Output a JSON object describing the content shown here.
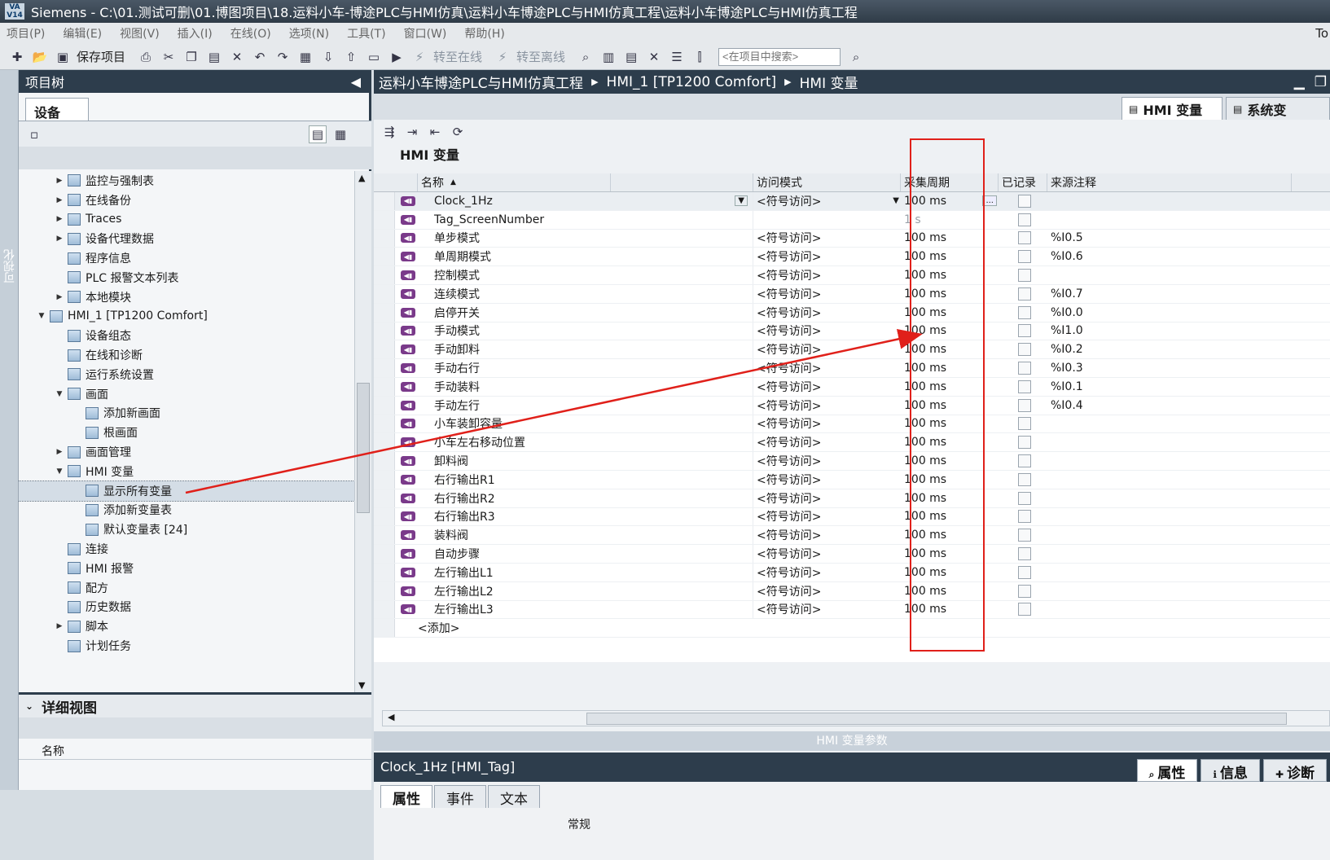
{
  "window": {
    "title": "Siemens  -  C:\\01.测试可删\\01.博图项目\\18.运料小车-博途PLC与HMI仿真\\运料小车博途PLC与HMI仿真工程\\运料小车博途PLC与HMI仿真工程",
    "logo": "VA V14",
    "right_text": "To"
  },
  "menu": [
    "项目(P)",
    "编辑(E)",
    "视图(V)",
    "插入(I)",
    "在线(O)",
    "选项(N)",
    "工具(T)",
    "窗口(W)",
    "帮助(H)"
  ],
  "toolbar": {
    "save_label": "保存项目",
    "go_online": "转至在线",
    "go_offline": "转至离线",
    "search_placeholder": "<在项目中搜索>"
  },
  "sidebar": {
    "vertical_label": "可视化"
  },
  "project_tree": {
    "title": "项目树",
    "tab": "设备",
    "items": [
      {
        "label": "监控与强制表",
        "level": 2,
        "arrow": "▶"
      },
      {
        "label": "在线备份",
        "level": 2,
        "arrow": "▶"
      },
      {
        "label": "Traces",
        "level": 2,
        "arrow": "▶"
      },
      {
        "label": "设备代理数据",
        "level": 2,
        "arrow": "▶"
      },
      {
        "label": "程序信息",
        "level": 2,
        "arrow": ""
      },
      {
        "label": "PLC 报警文本列表",
        "level": 2,
        "arrow": ""
      },
      {
        "label": "本地模块",
        "level": 2,
        "arrow": "▶"
      },
      {
        "label": "HMI_1 [TP1200 Comfort]",
        "level": 1,
        "arrow": "▼"
      },
      {
        "label": "设备组态",
        "level": 2,
        "arrow": ""
      },
      {
        "label": "在线和诊断",
        "level": 2,
        "arrow": ""
      },
      {
        "label": "运行系统设置",
        "level": 2,
        "arrow": ""
      },
      {
        "label": "画面",
        "level": 2,
        "arrow": "▼"
      },
      {
        "label": "添加新画面",
        "level": 3,
        "arrow": ""
      },
      {
        "label": "根画面",
        "level": 3,
        "arrow": ""
      },
      {
        "label": "画面管理",
        "level": 2,
        "arrow": "▶"
      },
      {
        "label": "HMI 变量",
        "level": 2,
        "arrow": "▼"
      },
      {
        "label": "显示所有变量",
        "level": 3,
        "arrow": "",
        "selected": true
      },
      {
        "label": "添加新变量表",
        "level": 3,
        "arrow": ""
      },
      {
        "label": "默认变量表 [24]",
        "level": 3,
        "arrow": ""
      },
      {
        "label": "连接",
        "level": 2,
        "arrow": ""
      },
      {
        "label": "HMI 报警",
        "level": 2,
        "arrow": ""
      },
      {
        "label": "配方",
        "level": 2,
        "arrow": ""
      },
      {
        "label": "历史数据",
        "level": 2,
        "arrow": ""
      },
      {
        "label": "脚本",
        "level": 2,
        "arrow": "▶"
      },
      {
        "label": "计划任务",
        "level": 2,
        "arrow": ""
      }
    ]
  },
  "detail_view": {
    "title": "详细视图",
    "column": "名称"
  },
  "breadcrumb": [
    "运料小车博途PLC与HMI仿真工程",
    "HMI_1 [TP1200 Comfort]",
    "HMI 变量"
  ],
  "editor_tabs": {
    "hmi_tags": "HMI 变量",
    "system_tags": "系统变"
  },
  "table": {
    "title": "HMI 变量",
    "columns": [
      "名称",
      "访问模式",
      "采集周期",
      "已记录",
      "来源注释"
    ],
    "rows": [
      {
        "name": "Clock_1Hz",
        "access": "<符号访问>",
        "cycle": "100 ms",
        "comment": ""
      },
      {
        "name": "Tag_ScreenNumber",
        "access": "",
        "cycle": "1 s",
        "comment": ""
      },
      {
        "name": "单步模式",
        "access": "<符号访问>",
        "cycle": "100 ms",
        "comment": "%I0.5"
      },
      {
        "name": "单周期模式",
        "access": "<符号访问>",
        "cycle": "100 ms",
        "comment": "%I0.6"
      },
      {
        "name": "控制模式",
        "access": "<符号访问>",
        "cycle": "100 ms",
        "comment": ""
      },
      {
        "name": "连续模式",
        "access": "<符号访问>",
        "cycle": "100 ms",
        "comment": "%I0.7"
      },
      {
        "name": "启停开关",
        "access": "<符号访问>",
        "cycle": "100 ms",
        "comment": "%I0.0"
      },
      {
        "name": "手动模式",
        "access": "<符号访问>",
        "cycle": "100 ms",
        "comment": "%I1.0"
      },
      {
        "name": "手动卸料",
        "access": "<符号访问>",
        "cycle": "100 ms",
        "comment": "%I0.2"
      },
      {
        "name": "手动右行",
        "access": "<符号访问>",
        "cycle": "100 ms",
        "comment": "%I0.3"
      },
      {
        "name": "手动装料",
        "access": "<符号访问>",
        "cycle": "100 ms",
        "comment": "%I0.1"
      },
      {
        "name": "手动左行",
        "access": "<符号访问>",
        "cycle": "100 ms",
        "comment": "%I0.4"
      },
      {
        "name": "小车装卸容量",
        "access": "<符号访问>",
        "cycle": "100 ms",
        "comment": ""
      },
      {
        "name": "小车左右移动位置",
        "access": "<符号访问>",
        "cycle": "100 ms",
        "comment": ""
      },
      {
        "name": "卸料阀",
        "access": "<符号访问>",
        "cycle": "100 ms",
        "comment": ""
      },
      {
        "name": "右行输出R1",
        "access": "<符号访问>",
        "cycle": "100 ms",
        "comment": ""
      },
      {
        "name": "右行输出R2",
        "access": "<符号访问>",
        "cycle": "100 ms",
        "comment": ""
      },
      {
        "name": "右行输出R3",
        "access": "<符号访问>",
        "cycle": "100 ms",
        "comment": ""
      },
      {
        "name": "装料阀",
        "access": "<符号访问>",
        "cycle": "100 ms",
        "comment": ""
      },
      {
        "name": "自动步骤",
        "access": "<符号访问>",
        "cycle": "100 ms",
        "comment": ""
      },
      {
        "name": "左行输出L1",
        "access": "<符号访问>",
        "cycle": "100 ms",
        "comment": ""
      },
      {
        "name": "左行输出L2",
        "access": "<符号访问>",
        "cycle": "100 ms",
        "comment": ""
      },
      {
        "name": "左行输出L3",
        "access": "<符号访问>",
        "cycle": "100 ms",
        "comment": ""
      }
    ],
    "add_row": "<添加>",
    "cycle_button": "..."
  },
  "params_bar": "HMI 变量参数",
  "inspector": {
    "title": "Clock_1Hz [HMI_Tag]",
    "tabs": [
      "属性",
      "事件",
      "文本"
    ],
    "panel_tabs": [
      "属性",
      "信息",
      "诊断"
    ],
    "section": "常规"
  },
  "colors": {
    "dark_header": "#2d3d4c",
    "annotation_red": "#e0201a",
    "tag_icon": "#7a3a8a"
  }
}
